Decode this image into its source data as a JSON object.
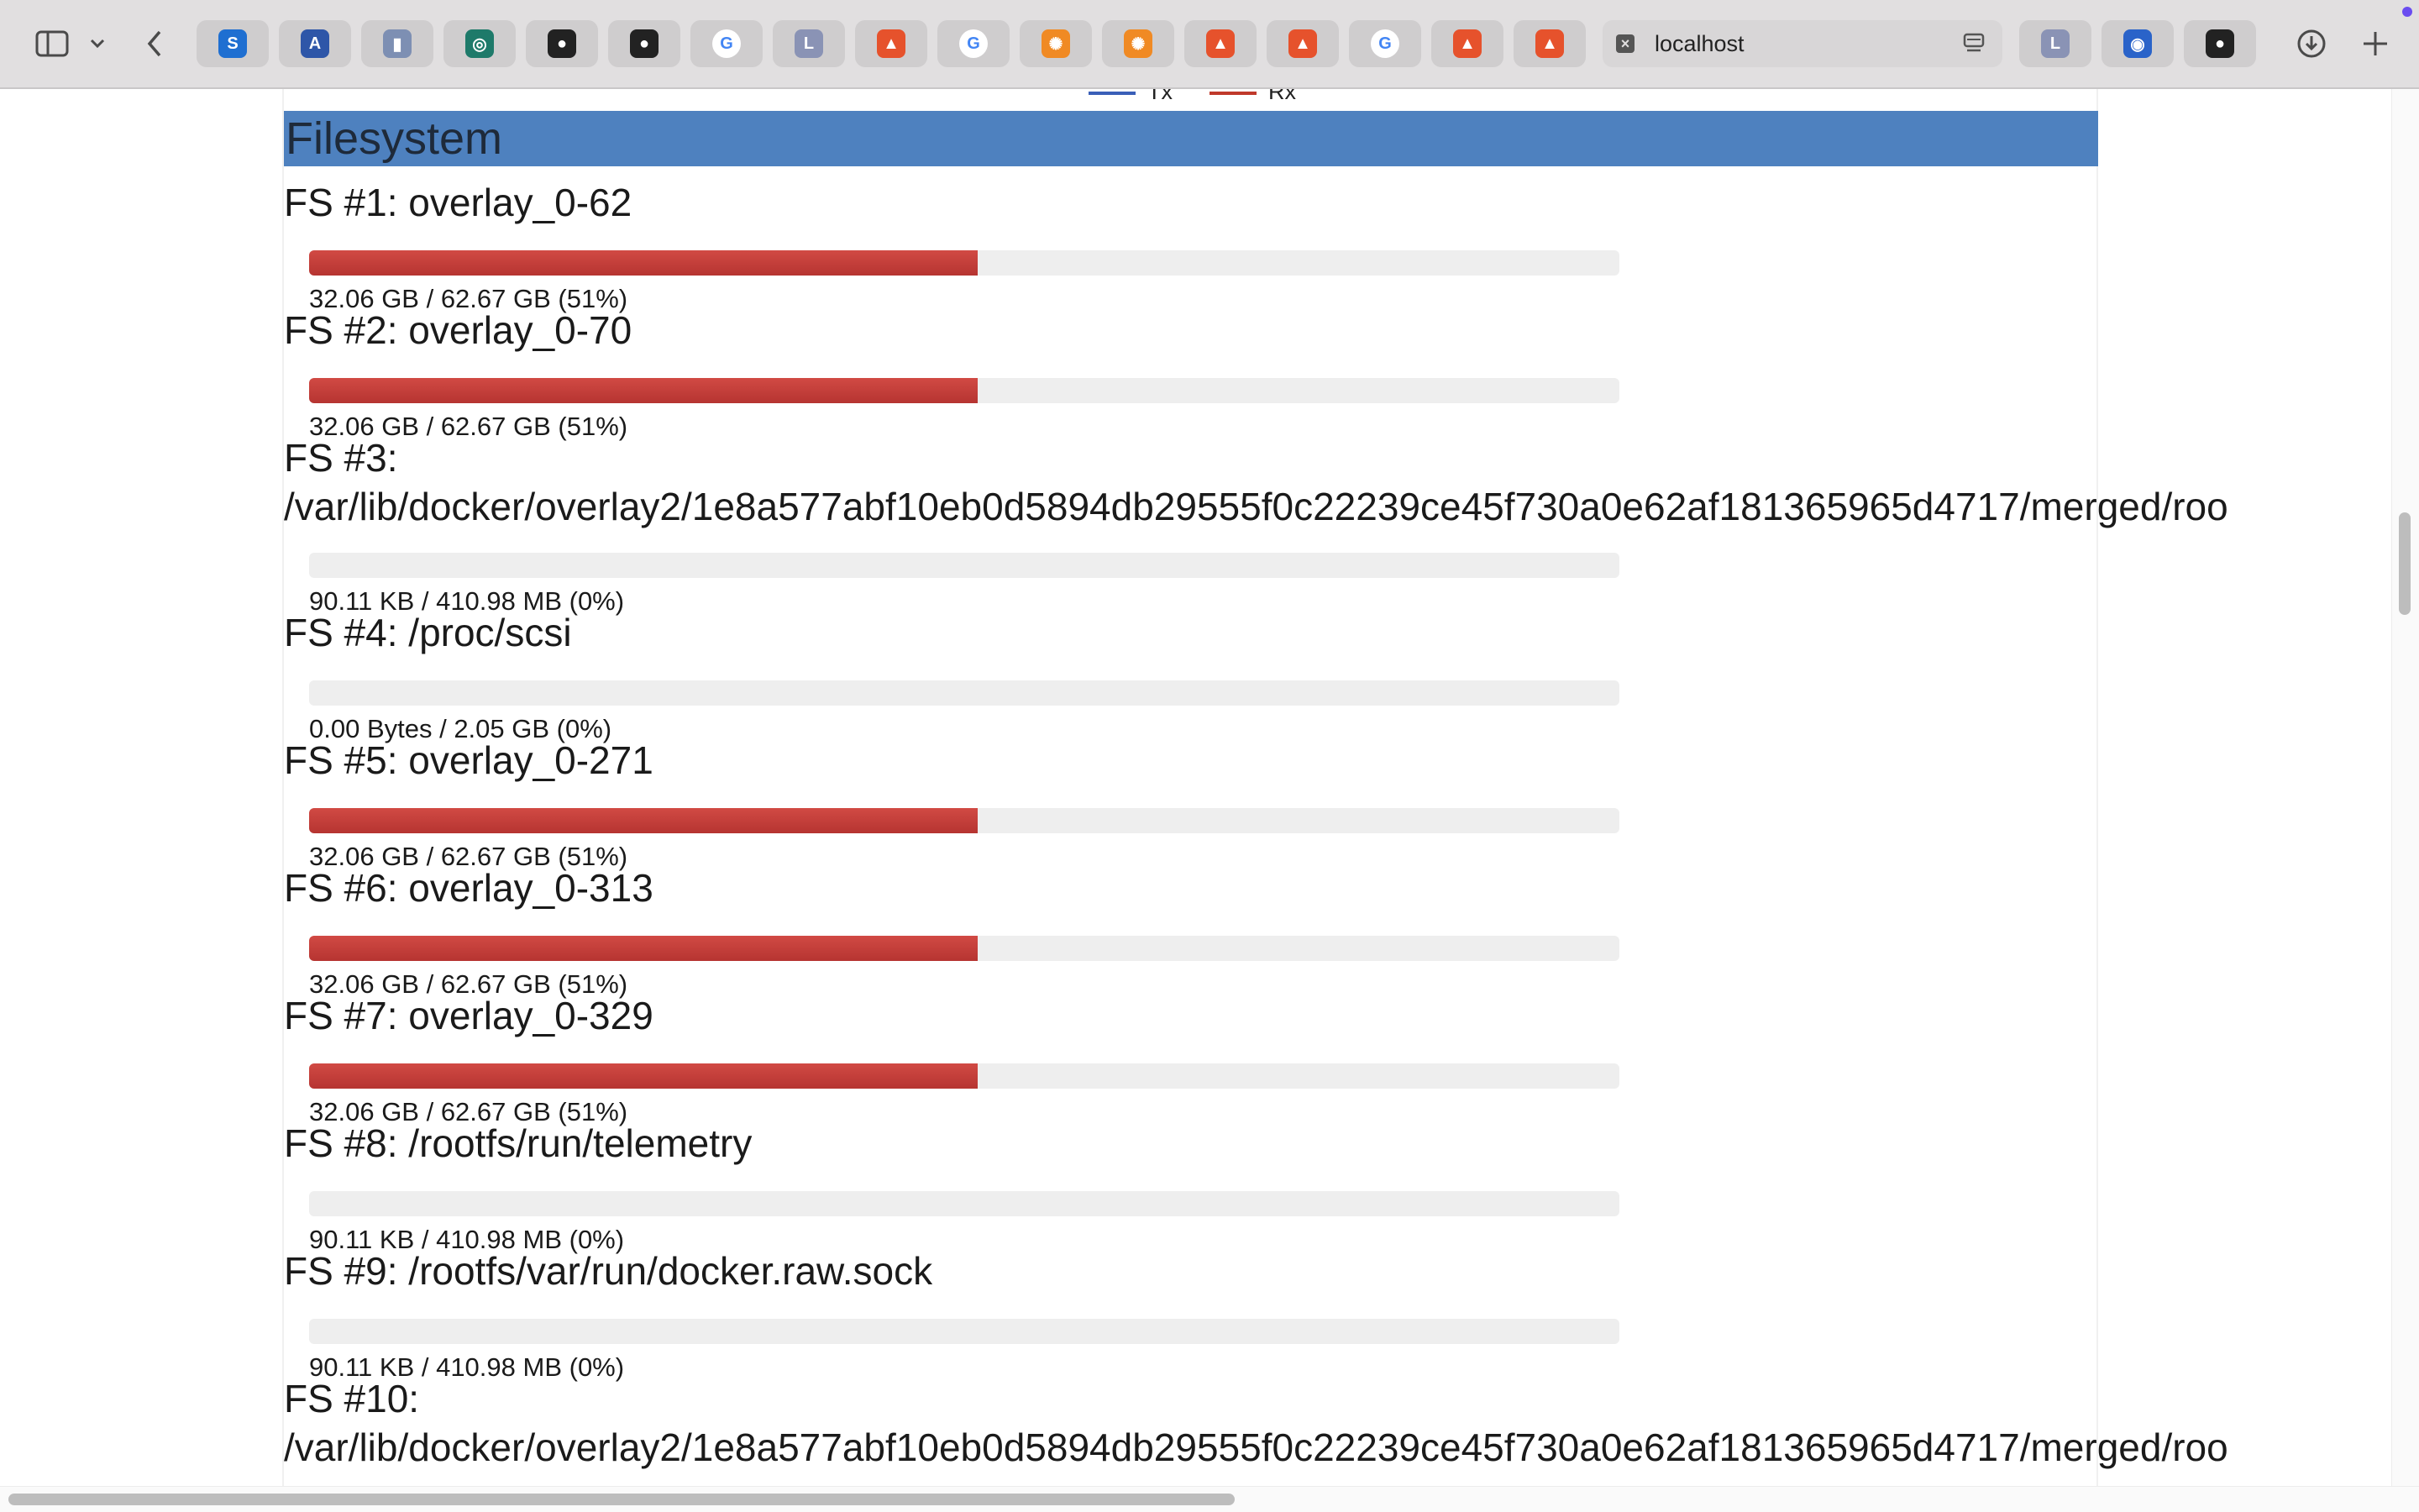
{
  "browser": {
    "active_tab_title": "localhost",
    "tabs": [
      {
        "icon": "s-app-icon",
        "letter": "S",
        "bg": "#1f6fd1"
      },
      {
        "icon": "translate-icon",
        "letter": "A",
        "bg": "#2e56a8"
      },
      {
        "icon": "bar-chart-icon",
        "letter": "▮",
        "bg": "#7d8fb3"
      },
      {
        "icon": "target-app-icon",
        "letter": "◎",
        "bg": "#1e7a6a"
      },
      {
        "icon": "github-icon",
        "letter": "●",
        "bg": "#222222"
      },
      {
        "icon": "github-icon",
        "letter": "●",
        "bg": "#222222"
      },
      {
        "icon": "google-icon",
        "letter": "G",
        "bg": "#ffffff"
      },
      {
        "icon": "l-app-icon",
        "letter": "L",
        "bg": "#8a93b5"
      },
      {
        "icon": "prometheus-icon",
        "letter": "▲",
        "bg": "#e6522c"
      },
      {
        "icon": "google-icon",
        "letter": "G",
        "bg": "#ffffff"
      },
      {
        "icon": "grafana-icon",
        "letter": "✺",
        "bg": "#f08a24"
      },
      {
        "icon": "grafana-icon",
        "letter": "✺",
        "bg": "#f08a24"
      },
      {
        "icon": "prometheus-icon",
        "letter": "▲",
        "bg": "#e6522c"
      },
      {
        "icon": "prometheus-icon",
        "letter": "▲",
        "bg": "#e6522c"
      },
      {
        "icon": "google-icon",
        "letter": "G",
        "bg": "#ffffff"
      },
      {
        "icon": "prometheus-icon",
        "letter": "▲",
        "bg": "#e6522c"
      },
      {
        "icon": "prometheus-icon",
        "letter": "▲",
        "bg": "#e6522c"
      }
    ],
    "right_tabs": [
      {
        "icon": "l-app-icon",
        "letter": "L",
        "bg": "#8a93b5"
      },
      {
        "icon": "edge-icon",
        "letter": "◉",
        "bg": "#2a63c9"
      },
      {
        "icon": "github-icon",
        "letter": "●",
        "bg": "#222222"
      }
    ]
  },
  "legend": {
    "tx_label": "Tx",
    "tx_color": "#3a5fb8",
    "rx_label": "Rx",
    "rx_color": "#c0392b"
  },
  "section_title": "Filesystem",
  "filesystems": [
    {
      "title": "FS #1: overlay_0-62",
      "usage": "32.06 GB / 62.67 GB (51%)",
      "percent": 51
    },
    {
      "title": "FS #2: overlay_0-70",
      "usage": "32.06 GB / 62.67 GB (51%)",
      "percent": 51
    },
    {
      "title": "FS #3:",
      "title_line2": "/var/lib/docker/overlay2/1e8a577abf10eb0d5894db29555f0c22239ce45f730a0e62af181365965d4717/merged/roo",
      "usage": "90.11 KB / 410.98 MB (0%)",
      "percent": 0
    },
    {
      "title": "FS #4: /proc/scsi",
      "usage": "0.00 Bytes / 2.05 GB (0%)",
      "percent": 0
    },
    {
      "title": "FS #5: overlay_0-271",
      "usage": "32.06 GB / 62.67 GB (51%)",
      "percent": 51
    },
    {
      "title": "FS #6: overlay_0-313",
      "usage": "32.06 GB / 62.67 GB (51%)",
      "percent": 51
    },
    {
      "title": "FS #7: overlay_0-329",
      "usage": "32.06 GB / 62.67 GB (51%)",
      "percent": 51
    },
    {
      "title": "FS #8: /rootfs/run/telemetry",
      "usage": "90.11 KB / 410.98 MB (0%)",
      "percent": 0
    },
    {
      "title": "FS #9: /rootfs/var/run/docker.raw.sock",
      "usage": "90.11 KB / 410.98 MB (0%)",
      "percent": 0
    },
    {
      "title": "FS #10:",
      "title_line2": "/var/lib/docker/overlay2/1e8a577abf10eb0d5894db29555f0c22239ce45f730a0e62af181365965d4717/merged/roo",
      "usage": "",
      "percent": 0
    }
  ]
}
